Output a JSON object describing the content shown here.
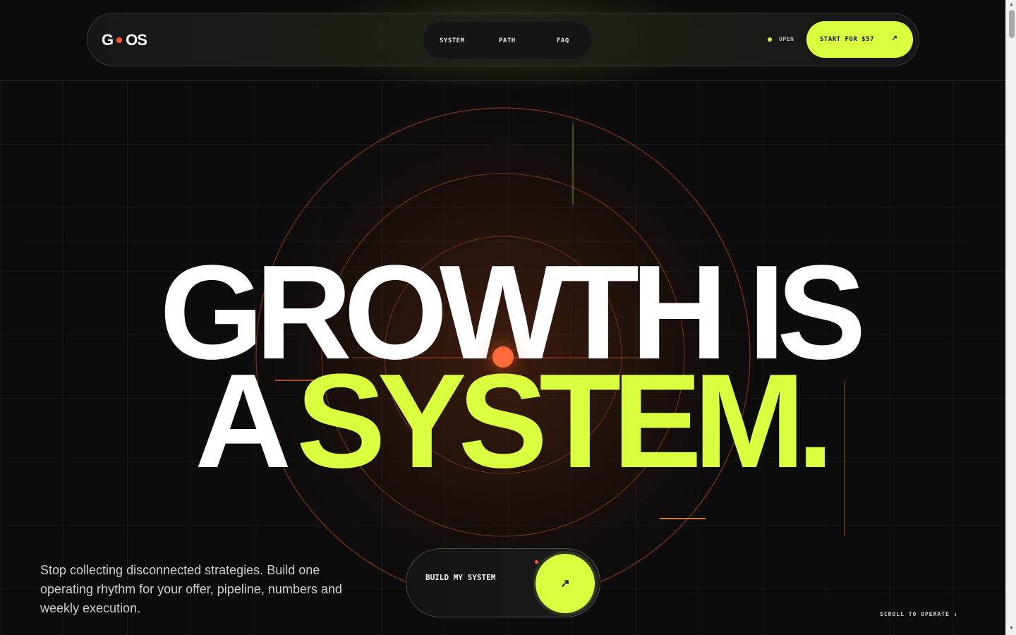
{
  "brand": {
    "logo_left": "G",
    "logo_right": "OS"
  },
  "nav": {
    "links": [
      "SYSTEM",
      "PATH",
      "FAQ"
    ],
    "status": "OPEN",
    "cta_label": "START FOR $57",
    "cta_arrow": "↗"
  },
  "hero": {
    "line1": "GROWTH IS",
    "line2_white": "A",
    "line2_accent": "SYSTEM."
  },
  "description": "Stop collecting disconnected strategies. Build one operating rhythm for your offer, pipeline, numbers and weekly execution.",
  "build": {
    "label": "BUILD MY SYSTEM",
    "arrow": "↗"
  },
  "scroll_hint": "SCROLL TO OPERATE ↓",
  "scrollbar": {
    "up": "▲",
    "down": "▼"
  },
  "colors": {
    "accent": "#d9ff3f",
    "orange": "#ff5a2a",
    "background": "#0c0c0c"
  },
  "icons": [
    "arrow-up-right-icon",
    "arrow-down-icon",
    "status-dot-icon"
  ]
}
